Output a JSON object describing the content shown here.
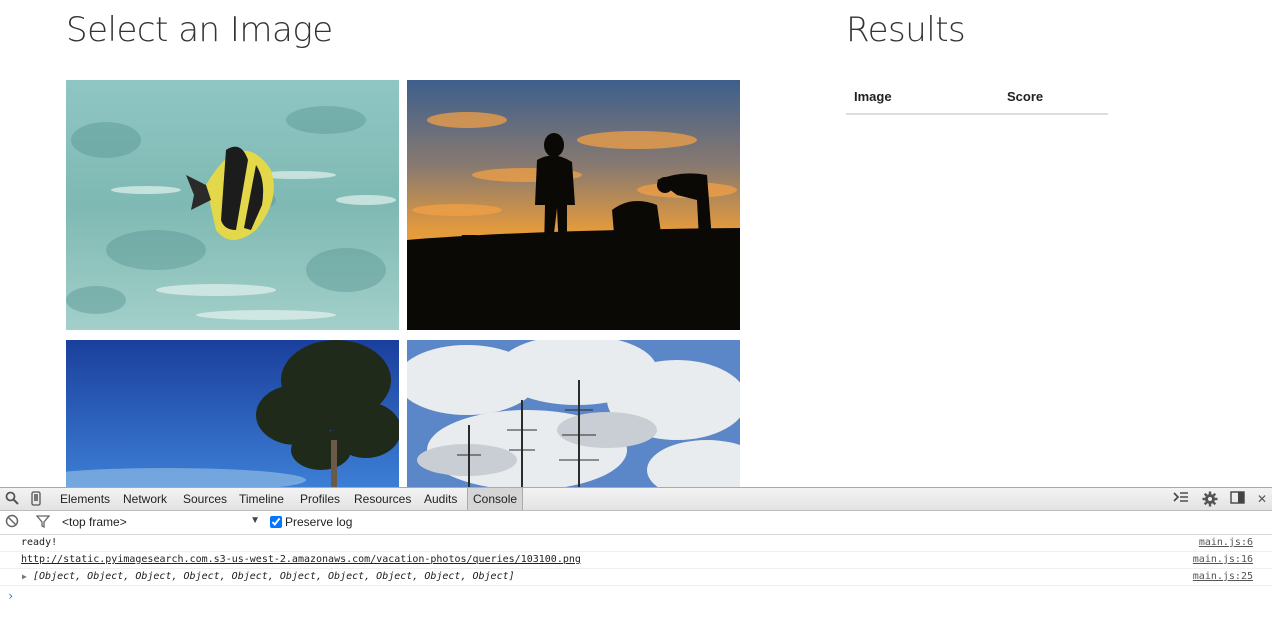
{
  "page": {
    "select_title": "Select an Image",
    "results_title": "Results",
    "results_table": {
      "columns": [
        "Image",
        "Score"
      ]
    }
  },
  "devtools": {
    "tabs": [
      "Elements",
      "Network",
      "Sources",
      "Timeline",
      "Profiles",
      "Resources",
      "Audits",
      "Console"
    ],
    "active_tab": "Console",
    "frame_select": "<top frame>",
    "preserve_log_label": "Preserve log",
    "preserve_log_checked": true,
    "console": [
      {
        "message": "ready!",
        "source": "main.js:6"
      },
      {
        "message": "http://static.pyimagesearch.com.s3-us-west-2.amazonaws.com/vacation-photos/queries/103100.png",
        "source": "main.js:16"
      },
      {
        "message": "[Object, Object, Object, Object, Object, Object, Object, Object, Object, Object]",
        "source": "main.js:25"
      }
    ],
    "prompt_symbol": "›",
    "icons": {
      "search": "search-icon",
      "device": "device-icon",
      "clear": "clear-icon",
      "filter": "filter-icon",
      "drawer": "console-drawer-icon",
      "settings": "gear-icon",
      "dock": "dock-icon",
      "close": "close-icon"
    }
  },
  "colors": {
    "link_prompt": "#2a7cd8",
    "table_border": "#dddddd"
  }
}
